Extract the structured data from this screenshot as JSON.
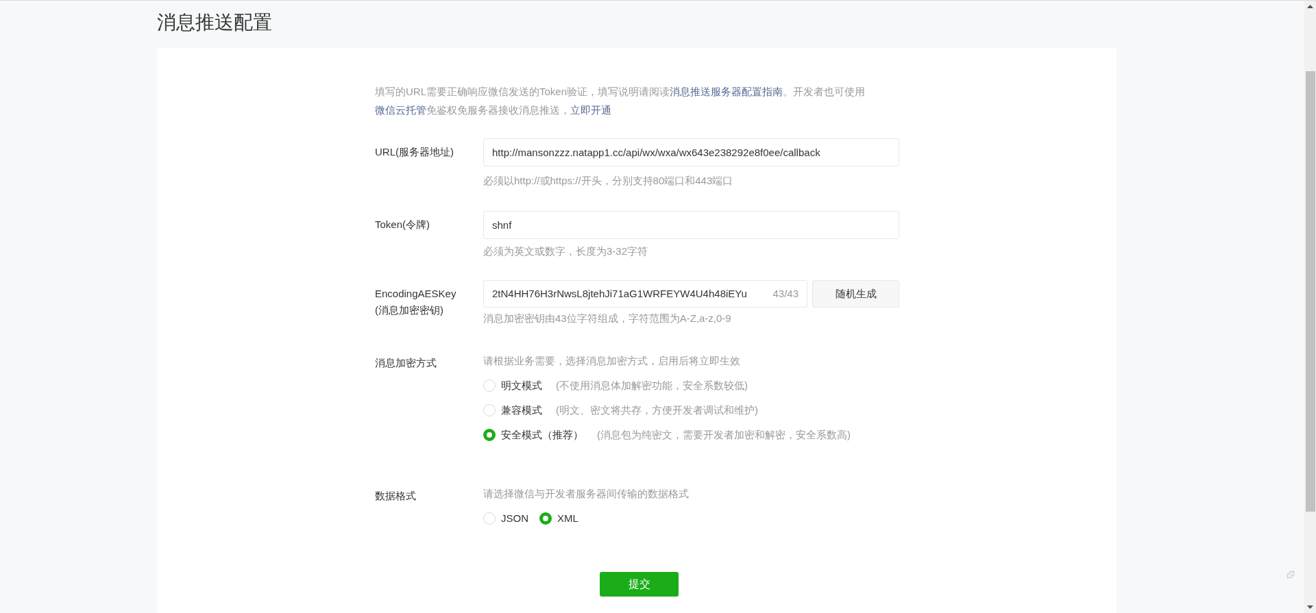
{
  "page_title": "消息推送配置",
  "intro": [
    {
      "kind": "text",
      "text": "填写的URL需要正确响应微信发送的Token验证，填写说明请阅读"
    },
    {
      "kind": "link",
      "text": "消息推送服务器配置指南"
    },
    {
      "kind": "text",
      "text": "。开发者也可使用"
    },
    {
      "kind": "link",
      "text": "微信云托管"
    },
    {
      "kind": "text",
      "text": "免鉴权免服务器接收消息推送，"
    },
    {
      "kind": "link",
      "text": "立即开通"
    }
  ],
  "url_field": {
    "label": "URL(服务器地址)",
    "value": "http://mansonzzz.natapp1.cc/api/wx/wxa/wx643e238292e8f0ee/callback",
    "hint": "必须以http://或https://开头，分别支持80端口和443端口"
  },
  "token_field": {
    "label": "Token(令牌)",
    "value": "shnf",
    "hint": "必须为英文或数字，长度为3-32字符"
  },
  "aes_field": {
    "label": "EncodingAESKey",
    "label_sub": "(消息加密密钥)",
    "value": "2tN4HH76H3rNwsL8jtehJi71aG1WRFEYW4U4h48iEYu",
    "count": "43/43",
    "button": "随机生成",
    "hint": "消息加密密钥由43位字符组成，字符范围为A-Z,a-z,0-9"
  },
  "encryption": {
    "label": "消息加密方式",
    "description": "请根据业务需要，选择消息加密方式，启用后将立即生效",
    "options": [
      {
        "label": "明文模式",
        "note": "(不使用消息体加解密功能，安全系数较低)",
        "selected": false
      },
      {
        "label": "兼容模式",
        "note": "(明文、密文将共存，方便开发者调试和维护)",
        "selected": false
      },
      {
        "label": "安全模式（推荐）",
        "note": "(消息包为纯密文，需要开发者加密和解密，安全系数高)",
        "selected": true
      }
    ]
  },
  "data_format": {
    "label": "数据格式",
    "description": "请选择微信与开发者服务器间传输的数据格式",
    "options": [
      {
        "label": "JSON",
        "selected": false
      },
      {
        "label": "XML",
        "selected": true
      }
    ]
  },
  "submit": "提交"
}
